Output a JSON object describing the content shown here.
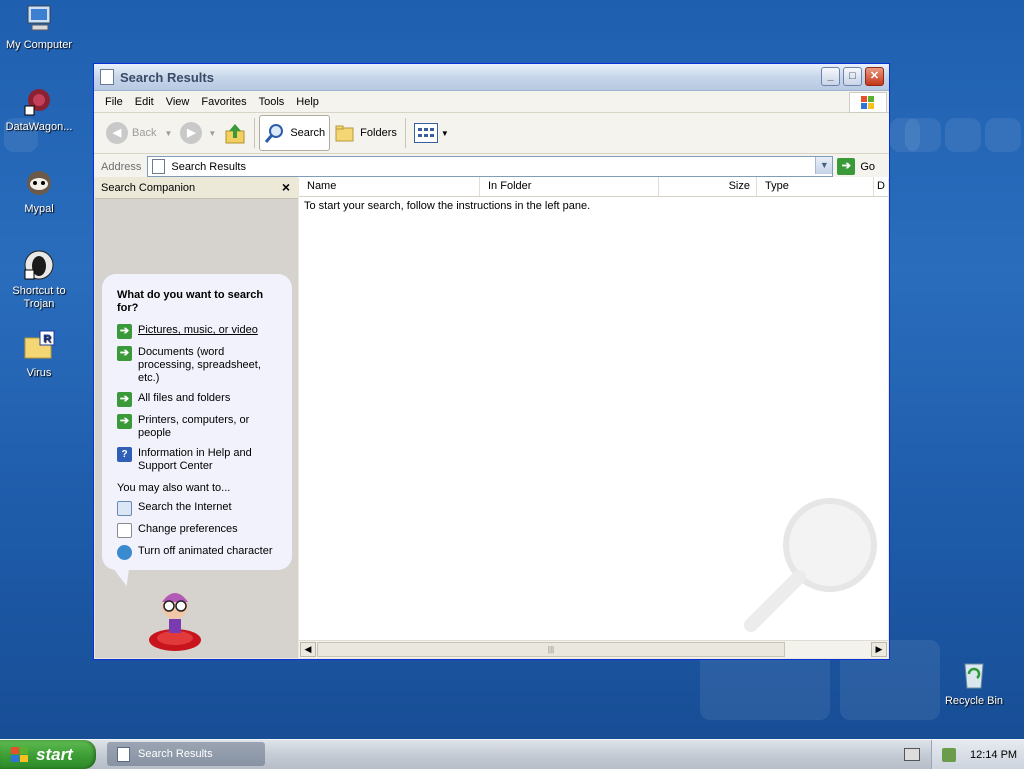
{
  "desktop": {
    "icons": [
      {
        "label": "My Computer"
      },
      {
        "label": "DataWagon..."
      },
      {
        "label": "Mypal"
      },
      {
        "label": "Shortcut to Trojan"
      },
      {
        "label": "Virus"
      },
      {
        "label": "Recycle Bin"
      }
    ]
  },
  "window": {
    "title": "Search Results",
    "menu": [
      "File",
      "Edit",
      "View",
      "Favorites",
      "Tools",
      "Help"
    ],
    "toolbar": {
      "back": "Back",
      "search": "Search",
      "folders": "Folders"
    },
    "address": {
      "label": "Address",
      "value": "Search Results",
      "go": "Go"
    },
    "companion": {
      "header": "Search Companion",
      "close": "×",
      "question": "What do you want to search for?",
      "options": [
        "Pictures, music, or video",
        "Documents (word processing, spreadsheet, etc.)",
        "All files and folders",
        "Printers, computers, or people",
        "Information in Help and Support Center"
      ],
      "also_label": "You may also want to...",
      "also_options": [
        "Search the Internet",
        "Change preferences",
        "Turn off animated character"
      ]
    },
    "results": {
      "columns": [
        "Name",
        "In Folder",
        "Size",
        "Type",
        "D"
      ],
      "message": "To start your search, follow the instructions in the left pane."
    }
  },
  "taskbar": {
    "start": "start",
    "task": "Search Results",
    "clock": "12:14 PM"
  }
}
